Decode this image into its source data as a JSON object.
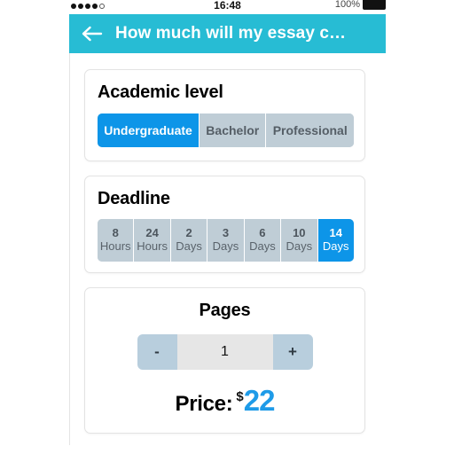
{
  "status_bar": {
    "signal_dots_filled": 4,
    "signal_dots_total": 5,
    "time": "16:48",
    "battery_percent": "100%"
  },
  "app_bar": {
    "back_icon": "arrow-left-icon",
    "title": "How much will my essay c…",
    "background_color": "#27bcd4"
  },
  "theme": {
    "accent_blue": "#0d95e8",
    "header_cyan": "#27bcd4",
    "segment_gray": "#bfcdd6",
    "price_blue": "#1e9be8"
  },
  "academic_level": {
    "title": "Academic level",
    "options": [
      {
        "label": "Undergraduate",
        "selected": true
      },
      {
        "label": "Bachelor",
        "selected": false
      },
      {
        "label": "Professional",
        "selected": false
      }
    ]
  },
  "deadline": {
    "title": "Deadline",
    "options": [
      {
        "num": "8",
        "unit": "Hours",
        "selected": false
      },
      {
        "num": "24",
        "unit": "Hours",
        "selected": false
      },
      {
        "num": "2",
        "unit": "Days",
        "selected": false
      },
      {
        "num": "3",
        "unit": "Days",
        "selected": false
      },
      {
        "num": "6",
        "unit": "Days",
        "selected": false
      },
      {
        "num": "10",
        "unit": "Days",
        "selected": false
      },
      {
        "num": "14",
        "unit": "Days",
        "selected": true
      }
    ]
  },
  "pages": {
    "title": "Pages",
    "decrement_label": "-",
    "increment_label": "+",
    "value": "1"
  },
  "price": {
    "label": "Price:",
    "currency": "$",
    "amount": "22"
  }
}
